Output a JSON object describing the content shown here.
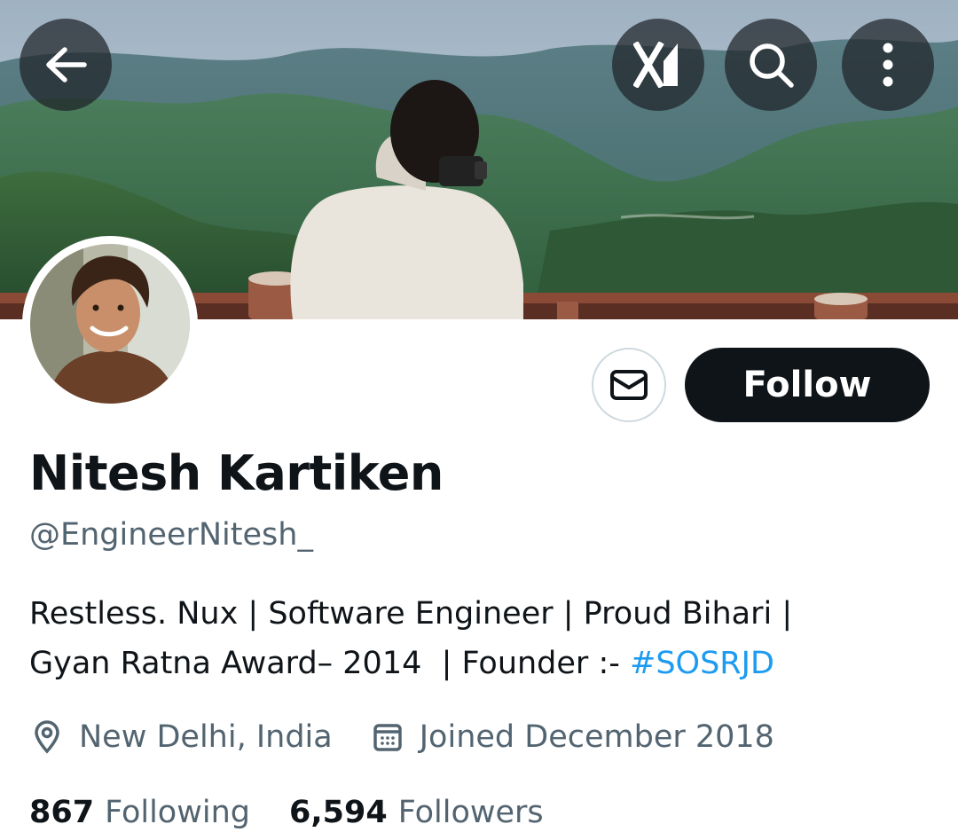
{
  "header": {
    "back_icon": "arrow-left-icon",
    "grok_icon": "grok-icon",
    "search_icon": "search-icon",
    "more_icon": "more-vertical-icon"
  },
  "profile": {
    "name": "Nitesh Kartiken",
    "handle": "@EngineerNitesh_",
    "bio_line1": "Restless. Nux | Software Engineer  | Proud Bihari  |",
    "bio_line2_text": "Gyan Ratna Award– 2014  | Founder :- ",
    "bio_hashtag": "#SOSRJD",
    "location": "New Delhi, India",
    "joined": "Joined December 2018"
  },
  "actions": {
    "message_icon": "mail-icon",
    "follow_label": "Follow"
  },
  "stats": {
    "following_count": "867",
    "following_label": "Following",
    "followers_count": "6,594",
    "followers_label": "Followers"
  },
  "colors": {
    "text_primary": "#0f1419",
    "text_secondary": "#536471",
    "accent": "#1d9bf0",
    "button_dark": "#0f1419"
  }
}
